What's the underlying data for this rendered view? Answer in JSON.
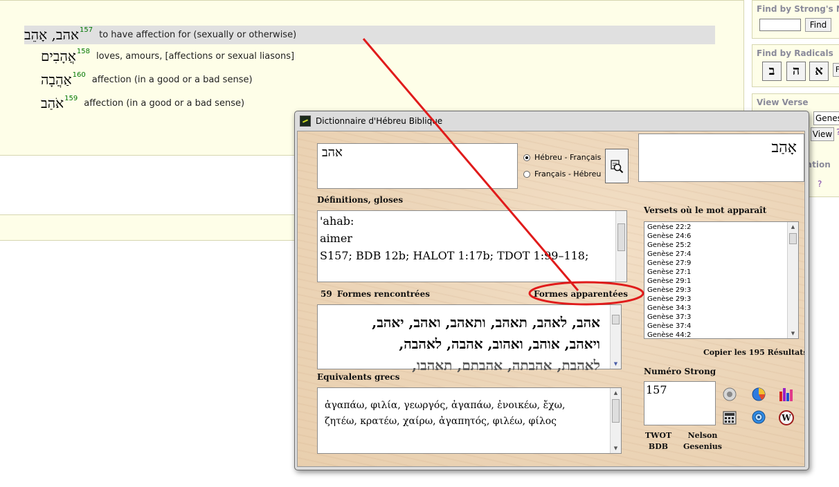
{
  "entries": [
    {
      "hebrew": "אהב, אָהֵב",
      "number": "157",
      "gloss": "to have affection for (sexually or otherwise)"
    },
    {
      "hebrew": "אֲהָבִים",
      "number": "158",
      "gloss": "loves, amours, [affections or sexual liasons]"
    },
    {
      "hebrew": "אַהֲבָה",
      "number": "160",
      "gloss": "affection (in a good or a bad sense)"
    },
    {
      "hebrew": "אֹהַב",
      "number": "159",
      "gloss": "affection (in a good or a bad sense)"
    }
  ],
  "right_panel": {
    "strongs_title": "Find by Strong's N",
    "find_button": "Find",
    "radicals_title": "Find by Radicals",
    "radicals": [
      "ב",
      "ה",
      "א"
    ],
    "radicals_more": "F",
    "view_verse_title": "View Verse",
    "book_value": "Genes",
    "view_button": "View",
    "question_mark": "?",
    "section_fragment": "ation",
    "question_mark_2": "?"
  },
  "dialog": {
    "title": "Dictionnaire d'Hébreu Biblique",
    "search_value": "אהב",
    "radio_options": [
      "Hébreu - Français",
      "Français - Hébreu"
    ],
    "selected_radio": "Hébreu - Français",
    "display_word": "אָהַב",
    "definitions_label": "Définitions, gloses",
    "definitions": [
      "'ahab:",
      "aimer",
      "S157; BDB 12b; HALOT 1:17b; TDOT 1:99–118;"
    ],
    "verses_label": "Versets où le mot apparaît",
    "verses": [
      "Genèse 22:2",
      "Genèse 24:6",
      "Genèse 25:2",
      "Genèse 27:4",
      "Genèse 27:9",
      "Genèse 27:1",
      "Genèse 29:1",
      "Genèse 29:3",
      "Genèse 29:3",
      "Genèse 34:3",
      "Genèse 37:3",
      "Genèse 37:4",
      "Genèse 44:2"
    ],
    "copy_results": "Copier les 195 Résultats",
    "forms_count": "59",
    "forms_label": "Formes rencontrées",
    "related_forms": "Formes apparentées",
    "forms_lines": [
      "אהב, לאהב, תאהב, ותאהב, ואהב, יאהב,",
      "ויאהב, אוהב, ואהוב, אהבה, לאהבה,",
      "לאהבת, אהבתה, אהבתם, תאהבו,"
    ],
    "greek_label": "Equivalents grecs",
    "greek_lines": [
      "ἀγαπάω, φιλία, γεωργός, ἀγαπάω, ἐνοικέω, ἔχω,",
      "ζητέω, κρατέω, χαίρω, ἀγαπητός, φιλέω, φίλος"
    ],
    "strong_label": "Numéro Strong",
    "strong_value": "157",
    "bottom_labels": [
      {
        "top": "TWOT",
        "bottom": "BDB"
      },
      {
        "top": "Nelson",
        "bottom": "Gesenius"
      }
    ]
  },
  "annotation_color": "#e01b1b"
}
